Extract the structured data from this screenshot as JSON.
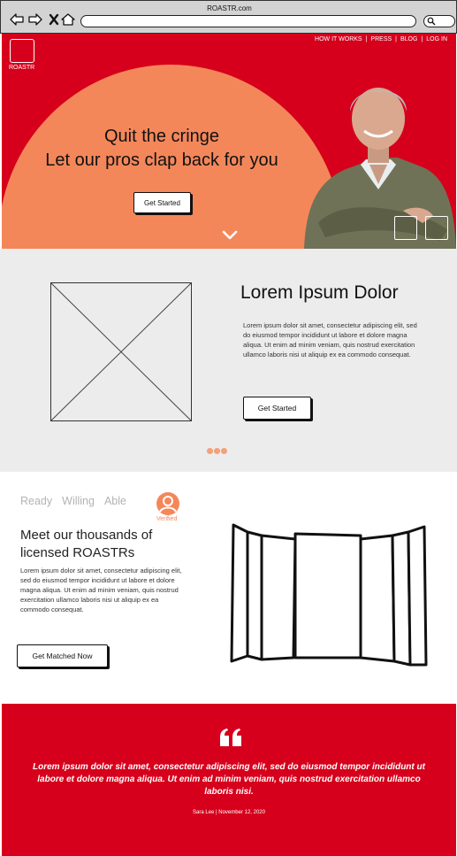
{
  "browser": {
    "title": "ROASTR.com",
    "icons": [
      "back-arrow-icon",
      "forward-arrow-icon",
      "close-icon",
      "home-icon",
      "search-icon"
    ]
  },
  "hero": {
    "logo_text": "ROASTR",
    "nav": {
      "how_it_works": "HOW IT WORKS",
      "press": "PRESS",
      "blog": "BLOG",
      "login": "LOG IN",
      "separator": "|"
    },
    "title_line1": "Quit the cringe",
    "title_line2": "Let our pros clap back for you",
    "cta_label": "Get Started",
    "colors": {
      "background": "#d6001c",
      "arc": "#f4875a"
    }
  },
  "feature": {
    "title": "Lorem Ipsum Dolor",
    "body": "Lorem ipsum dolor sit amet, consectetur adipiscing elit, sed do eiusmod tempor incididunt ut labore et dolore magna aliqua. Ut enim ad minim veniam, quis nostrud exercitation ullamco laboris nisi ut aliquip ex ea commodo consequat.",
    "cta_label": "Get Started"
  },
  "pros": {
    "tags": [
      "Ready",
      "Willing",
      "Able"
    ],
    "verified_label": "Verified",
    "title": "Meet our thousands of licensed ROASTRs",
    "body": "Lorem ipsum dolor sit amet, consectetur adipiscing elit, sed do eiusmod tempor incididunt ut labore et dolore magna aliqua. Ut enim ad minim veniam, quis nostrud exercitation ullamco laboris nisi ut aliquip ex ea commodo consequat.",
    "cta_label": "Get Matched Now"
  },
  "testimonial": {
    "quote": "Lorem ipsum dolor sit amet, consectetur adipiscing elit, sed do eiusmod tempor incididunt ut labore et dolore magna aliqua. Ut enim ad minim veniam, quis nostrud exercitation ullamco laboris nisi.",
    "author": "Sara Lee | November 12, 2020"
  }
}
